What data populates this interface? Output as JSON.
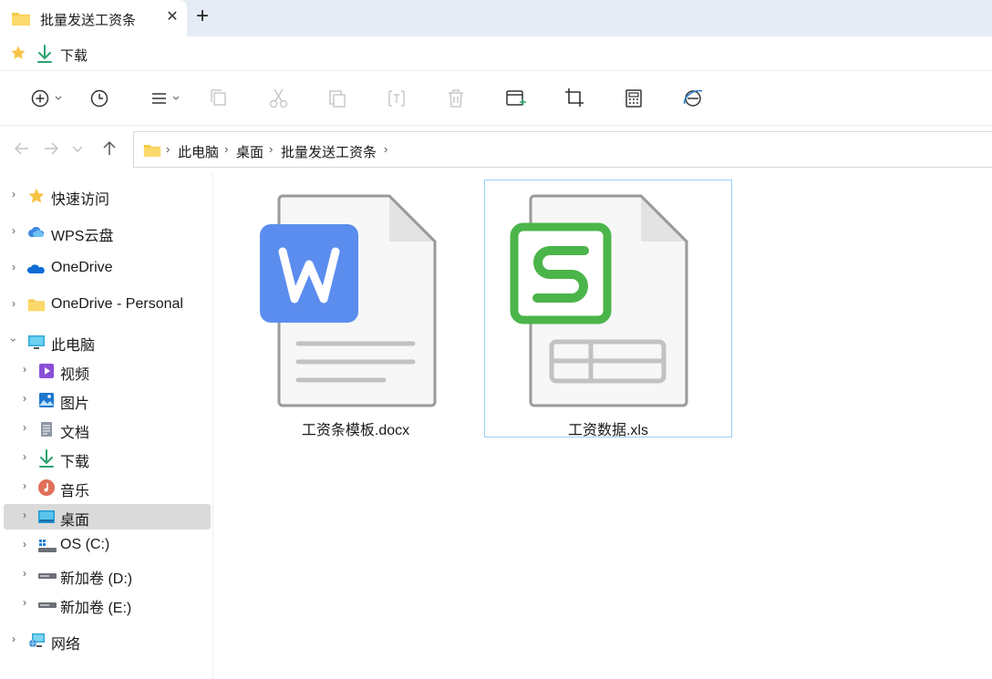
{
  "tab": {
    "title": "批量发送工资条",
    "close": "✕",
    "new_tab": "+"
  },
  "favorites": {
    "download_label": "下载"
  },
  "breadcrumb": [
    "此电脑",
    "桌面",
    "批量发送工资条"
  ],
  "sidebar": {
    "items": [
      {
        "label": "快速访问"
      },
      {
        "label": "WPS云盘"
      },
      {
        "label": "OneDrive"
      },
      {
        "label": "OneDrive - Personal"
      },
      {
        "label": "此电脑"
      },
      {
        "label": "视频"
      },
      {
        "label": "图片"
      },
      {
        "label": "文档"
      },
      {
        "label": "下载"
      },
      {
        "label": "音乐"
      },
      {
        "label": "桌面"
      },
      {
        "label": "OS (C:)"
      },
      {
        "label": "新加卷 (D:)"
      },
      {
        "label": "新加卷 (E:)"
      },
      {
        "label": "网络"
      }
    ]
  },
  "files": [
    {
      "name": "工资条模板.docx",
      "icon": "wps-writer-doc-icon"
    },
    {
      "name": "工资数据.xls",
      "icon": "wps-spreadsheet-icon"
    }
  ],
  "colors": {
    "accent": "#99d1f3",
    "wps_blue": "#5b8def",
    "wps_green": "#4bb54a",
    "folder_yellow": "#f7c948"
  }
}
